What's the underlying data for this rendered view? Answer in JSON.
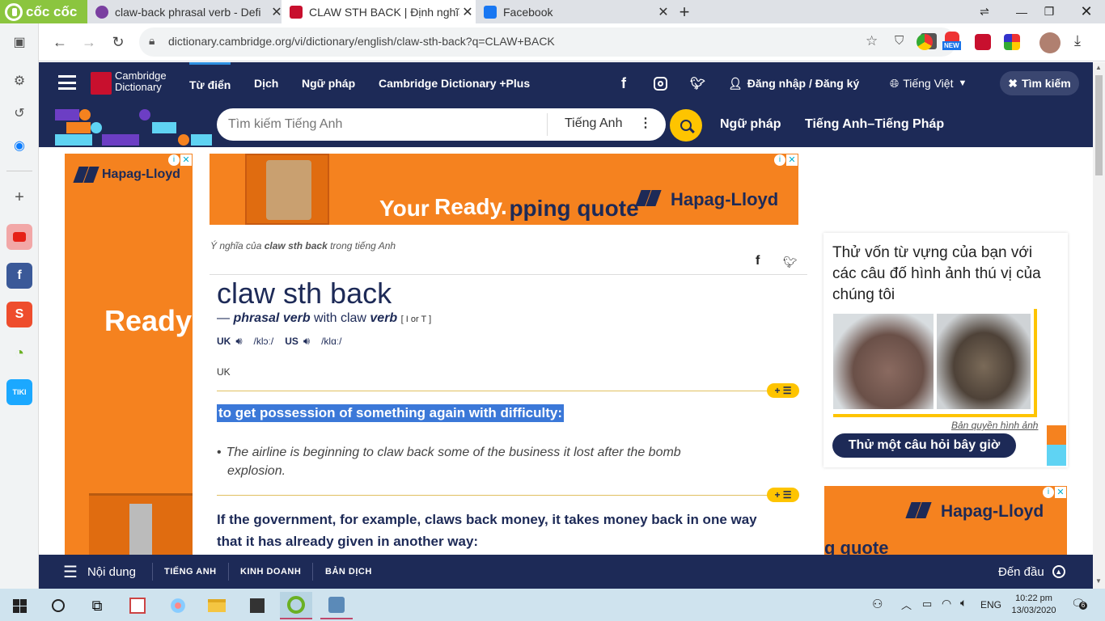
{
  "browser": {
    "brand": "cốc cốc",
    "tabs": [
      {
        "label": "claw-back phrasal verb - Defi",
        "active": false,
        "color": "#7a3fa0"
      },
      {
        "label": "CLAW STH BACK | Định nghĩa",
        "active": true,
        "color": "#c8102e"
      },
      {
        "label": "Facebook",
        "active": false,
        "color": "#1877f2"
      }
    ],
    "new_tab": "+",
    "url": "dictionary.cambridge.org/vi/dictionary/english/claw-sth-back?q=CLAW+BACK",
    "ext_badge": "NEW"
  },
  "site": {
    "logo_line1": "Cambridge",
    "logo_line2": "Dictionary",
    "nav": [
      "Từ điển",
      "Dịch",
      "Ngữ pháp",
      "Cambridge Dictionary +Plus"
    ],
    "login": "Đăng nhập / Đăng ký",
    "language": "Tiếng Việt",
    "search_toggle": "Tìm kiếm",
    "search_placeholder": "Tìm kiếm Tiếng Anh",
    "search_lang": "Tiếng Anh",
    "quick_links": [
      "Ngữ pháp",
      "Tiếng Anh–Tiếng Pháp"
    ]
  },
  "ads": {
    "brand": "Hapag-Lloyd",
    "left_text": "Ready",
    "top_text_a": "Your",
    "top_text_b": "Ready.",
    "top_text_c": "shipping quote",
    "right_text": "g quote"
  },
  "entry": {
    "breadcrumb_pre": "Ý nghĩa của ",
    "breadcrumb_word": "claw sth back",
    "breadcrumb_post": " trong tiếng Anh",
    "headword": "claw sth back",
    "dash": "—",
    "pos": "phrasal verb",
    "with_text": " with claw ",
    "verb": "verb",
    "grammar": "[ I or T ]",
    "uk_label": "UK",
    "uk_ipa": "/klɔː/",
    "us_label": "US",
    "us_ipa": "/klɑː/",
    "region": "UK",
    "sense1_def": "to get possession of something again with difficulty:",
    "sense1_example_line1": "The airline is beginning to claw back some of the business it lost after the bomb",
    "sense1_example_line2": "explosion.",
    "sense2_def_line1": "If the government, for example, claws back money, it takes money back in one way",
    "sense2_def_line2": "that it has already given in another way:",
    "plus_label": "+ ☰"
  },
  "quiz": {
    "title": "Thử vốn từ vựng của bạn với các câu đố hình ảnh thú vị của chúng tôi",
    "credit": "Bản quyền hình ảnh",
    "button": "Thử một câu hỏi bây giờ"
  },
  "content_bar": {
    "menu": "Nội dung",
    "links": [
      "TIẾNG ANH",
      "KINH DOANH",
      "BẢN DỊCH"
    ],
    "top": "Đến đầu"
  },
  "taskbar": {
    "lang": "ENG",
    "time": "10:22 pm",
    "date": "13/03/2020",
    "notif_count": "6"
  },
  "colors": {
    "cambridge_navy": "#1d2a57",
    "highlight_blue": "#3b78d8",
    "accent_yellow": "#fec400",
    "ad_orange": "#f5821f"
  }
}
